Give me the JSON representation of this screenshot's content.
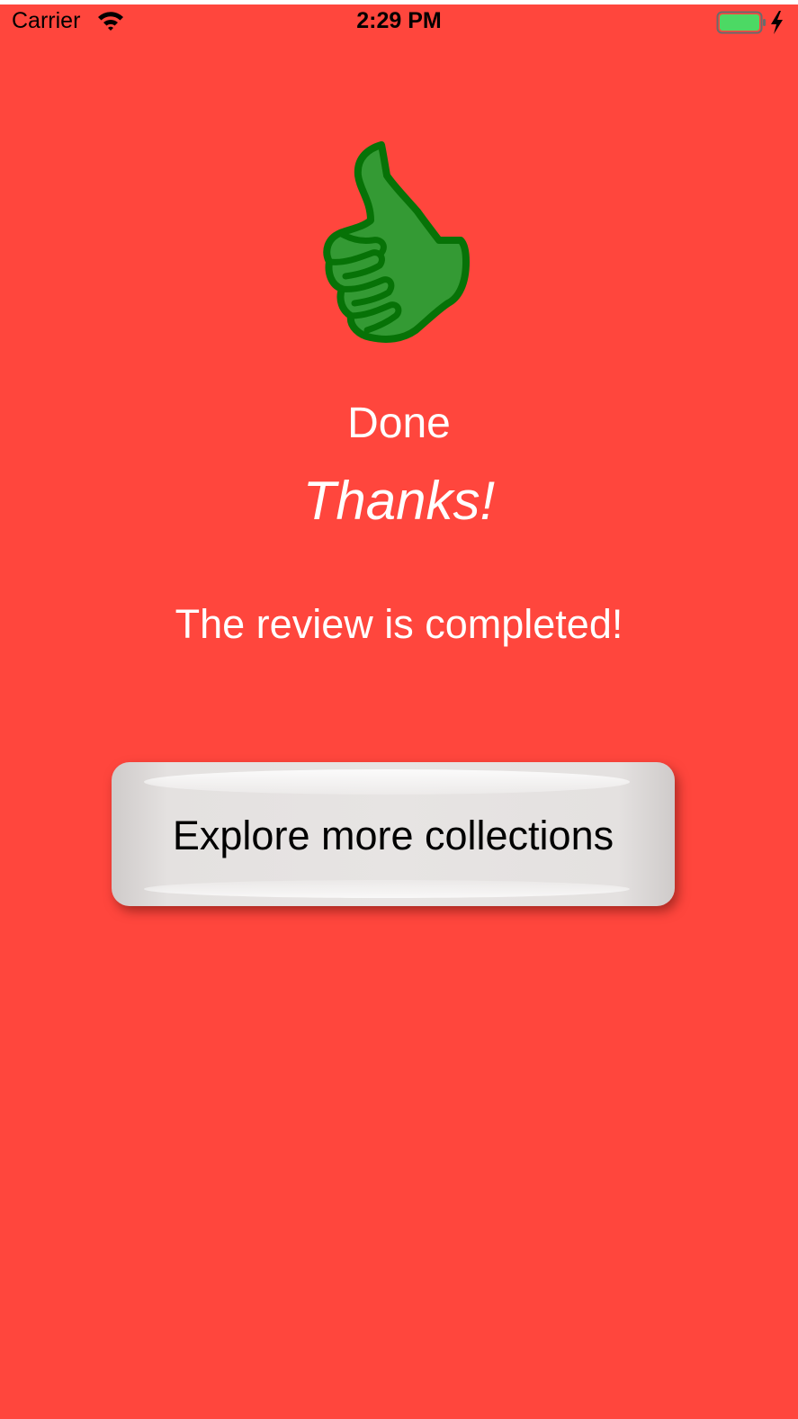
{
  "status_bar": {
    "carrier": "Carrier",
    "time": "2:29 PM",
    "wifi_icon": "wifi-icon",
    "battery_icon": "battery-charging-icon"
  },
  "content": {
    "icon": "thumbs-up-icon",
    "title": "Done",
    "subtitle": "Thanks!",
    "message": "The review is completed!"
  },
  "button": {
    "label": "Explore more collections"
  },
  "colors": {
    "background": "#ff463d",
    "text": "#ffffff",
    "thumb_fill": "#349a34",
    "thumb_stroke": "#077207",
    "button_face": "#e6e3e2",
    "battery_fill": "#4cd964"
  }
}
